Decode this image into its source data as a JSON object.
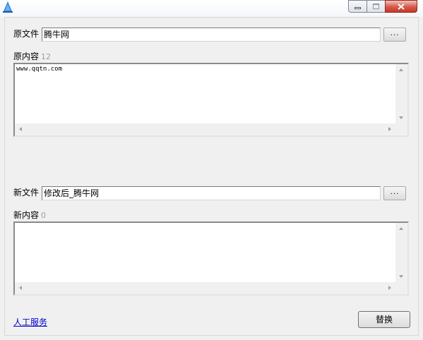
{
  "window": {
    "app_icon": "cone-shaped app icon",
    "caption_buttons": {
      "minimize": "minimize-icon",
      "maximize": "maximize-icon",
      "close": "close-icon"
    }
  },
  "original": {
    "file_label": "原文件",
    "file_value": "腾牛网",
    "browse_label": "...",
    "content_label": "原内容",
    "content_count": "12",
    "content_text": "www.qqtn.com"
  },
  "new": {
    "file_label": "新文件",
    "file_value": "修改后_腾牛网",
    "browse_label": "...",
    "content_label": "新内容",
    "content_count": "0",
    "content_text": ""
  },
  "footer": {
    "service_link": "人工服务",
    "replace_button": "替换"
  },
  "colors": {
    "background": "#f0f0f0",
    "link": "#0000cc",
    "count": "#a0a0a0",
    "close_button": "#c6382a"
  }
}
